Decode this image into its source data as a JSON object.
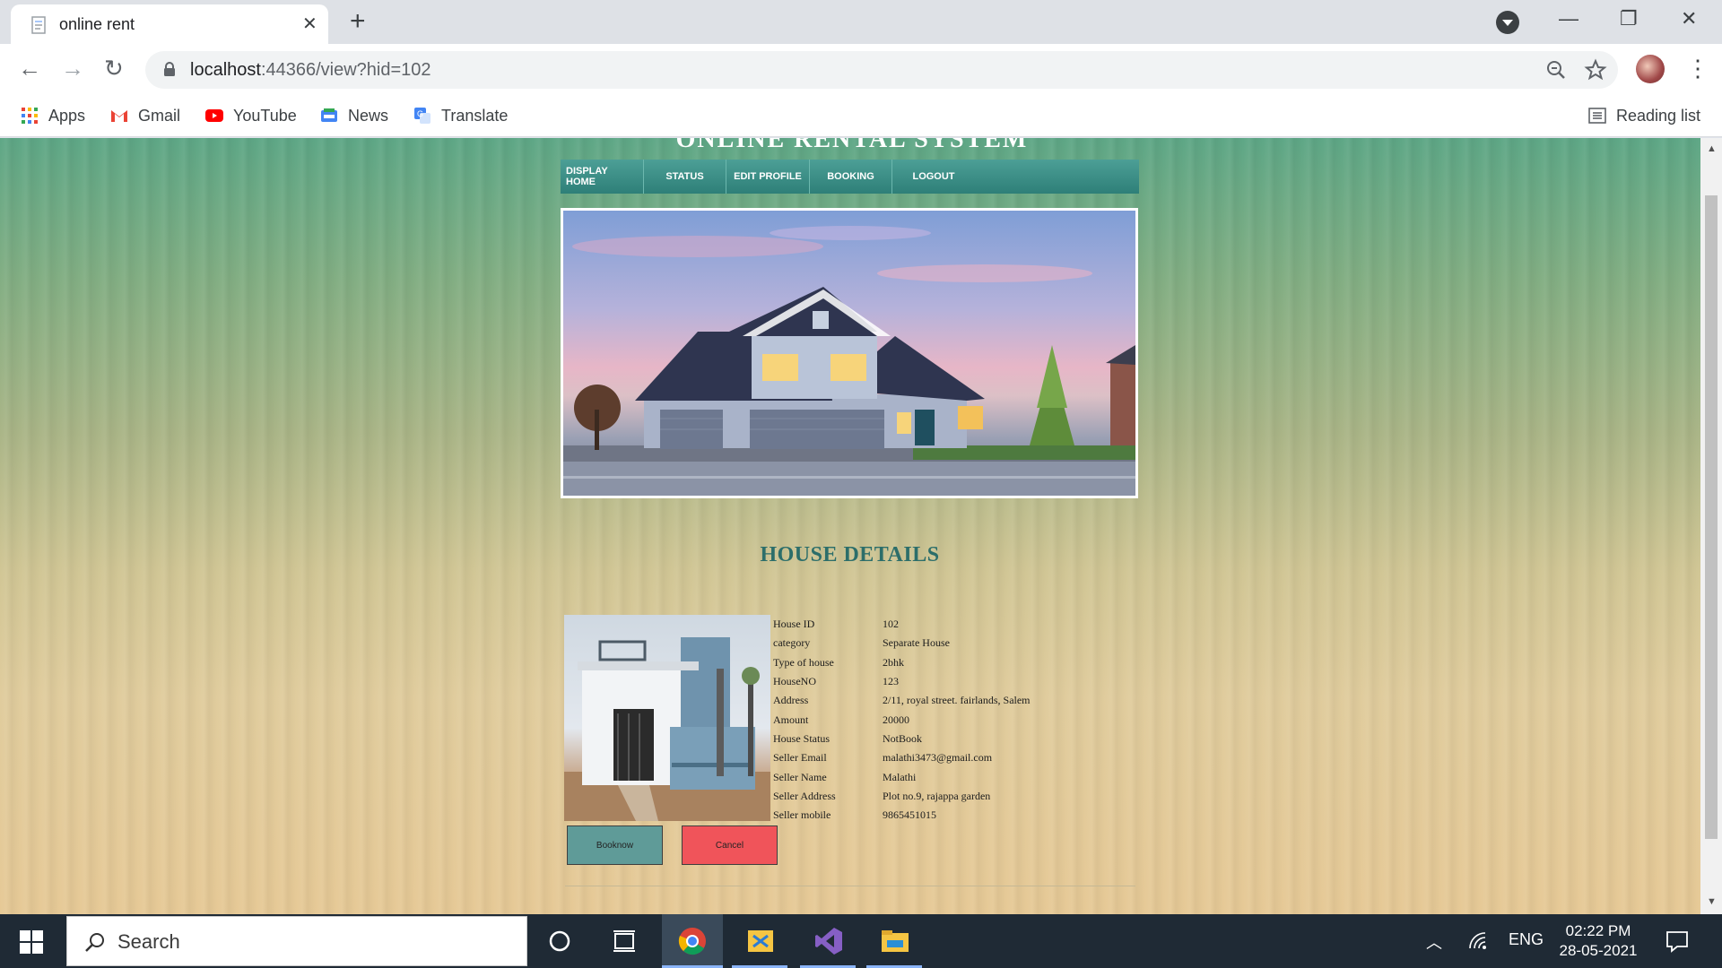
{
  "browser": {
    "tab_title": "online rent",
    "url_host": "localhost",
    "url_rest": ":44366/view?hid=102",
    "bookmarks": [
      {
        "label": "Apps",
        "icon": "apps-grid-icon"
      },
      {
        "label": "Gmail",
        "icon": "gmail-icon"
      },
      {
        "label": "YouTube",
        "icon": "youtube-icon"
      },
      {
        "label": "News",
        "icon": "news-icon"
      },
      {
        "label": "Translate",
        "icon": "translate-icon"
      }
    ],
    "reading_list": "Reading list"
  },
  "site": {
    "title": "ONLINE RENTAL SYSTEM",
    "menu": [
      "DISPLAY HOME",
      "STATUS",
      "EDIT PROFILE",
      "BOOKING",
      "LOGOUT"
    ]
  },
  "details": {
    "heading": "HOUSE DETAILS",
    "rows": [
      {
        "label": "House ID",
        "value": "102"
      },
      {
        "label": "category",
        "value": "Separate House"
      },
      {
        "label": "Type of house",
        "value": "2bhk"
      },
      {
        "label": "HouseNO",
        "value": "123"
      },
      {
        "label": "Address",
        "value": "2/11, royal street. fairlands, Salem"
      },
      {
        "label": "Amount",
        "value": "20000"
      },
      {
        "label": "House Status",
        "value": "NotBook"
      },
      {
        "label": "Seller Email",
        "value": "malathi3473@gmail.com"
      },
      {
        "label": "Seller Name",
        "value": "Malathi"
      },
      {
        "label": "Seller Address",
        "value": "Plot no.9, rajappa garden"
      },
      {
        "label": "Seller mobile",
        "value": "9865451015"
      }
    ],
    "book_label": "Booknow",
    "cancel_label": "Cancel"
  },
  "taskbar": {
    "search_placeholder": "Search",
    "language": "ENG",
    "time": "02:22 PM",
    "date": "28-05-2021"
  },
  "colors": {
    "menu_bar": "#3a8f88",
    "heading": "#2c6e6a",
    "book_button": "#5f9b98",
    "cancel_button": "#f0545a"
  }
}
